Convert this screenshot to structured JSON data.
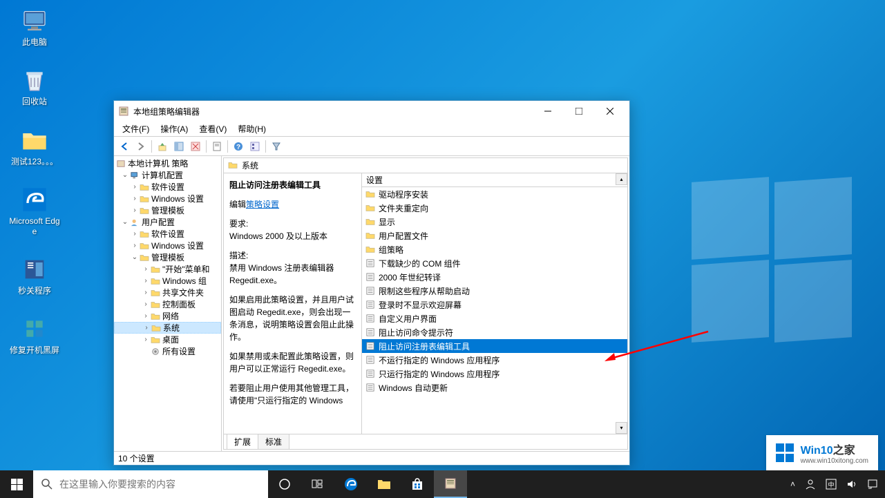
{
  "desktop": {
    "icons": [
      {
        "name": "此电脑",
        "type": "pc"
      },
      {
        "name": "回收站",
        "type": "recycle"
      },
      {
        "name": "测试123。。。",
        "type": "folder"
      },
      {
        "name": "Microsoft Edge",
        "type": "edge"
      },
      {
        "name": "秒关程序",
        "type": "app"
      },
      {
        "name": "修复开机黑屏",
        "type": "app2"
      }
    ]
  },
  "window": {
    "title": "本地组策略编辑器",
    "menus": [
      "文件(F)",
      "操作(A)",
      "查看(V)",
      "帮助(H)"
    ],
    "status": "10 个设置",
    "tabs": [
      "扩展",
      "标准"
    ],
    "active_tab": 0
  },
  "tree": {
    "root": "本地计算机 策略",
    "computer_config": "计算机配置",
    "computer_children": [
      "软件设置",
      "Windows 设置",
      "管理模板"
    ],
    "user_config": "用户配置",
    "user_children": [
      "软件设置",
      "Windows 设置"
    ],
    "admin_templates": "管理模板",
    "admin_children": [
      "\"开始\"菜单和",
      "Windows 组",
      "共享文件夹",
      "控制面板",
      "网络",
      "系统",
      "桌面",
      "所有设置"
    ],
    "selected": "系统"
  },
  "right": {
    "header": "系统",
    "list_header": "设置",
    "detail": {
      "title": "阻止访问注册表编辑工具",
      "edit_label": "编辑",
      "edit_link": "策略设置",
      "req_label": "要求:",
      "req_value": "Windows 2000 及以上版本",
      "desc_label": "描述:",
      "desc_p1": "禁用 Windows 注册表编辑器 Regedit.exe。",
      "desc_p2": "如果启用此策略设置，并且用户试图启动 Regedit.exe，则会出现一条消息，说明策略设置会阻止此操作。",
      "desc_p3": "如果禁用或未配置此策略设置，则用户可以正常运行 Regedit.exe。",
      "desc_p4": "若要阻止用户使用其他管理工具，请使用\"只运行指定的 Windows"
    },
    "items": [
      {
        "label": "驱动程序安装",
        "type": "folder"
      },
      {
        "label": "文件夹重定向",
        "type": "folder"
      },
      {
        "label": "显示",
        "type": "folder"
      },
      {
        "label": "用户配置文件",
        "type": "folder"
      },
      {
        "label": "组策略",
        "type": "folder"
      },
      {
        "label": "下载缺少的 COM 组件",
        "type": "setting"
      },
      {
        "label": "2000 年世纪转译",
        "type": "setting"
      },
      {
        "label": "限制这些程序从帮助启动",
        "type": "setting"
      },
      {
        "label": "登录时不显示欢迎屏幕",
        "type": "setting"
      },
      {
        "label": "自定义用户界面",
        "type": "setting"
      },
      {
        "label": "阻止访问命令提示符",
        "type": "setting"
      },
      {
        "label": "阻止访问注册表编辑工具",
        "type": "setting",
        "selected": true
      },
      {
        "label": "不运行指定的 Windows 应用程序",
        "type": "setting"
      },
      {
        "label": "只运行指定的 Windows 应用程序",
        "type": "setting"
      },
      {
        "label": "Windows 自动更新",
        "type": "setting"
      }
    ]
  },
  "taskbar": {
    "search_placeholder": "在这里输入你要搜索的内容"
  },
  "watermark": {
    "brand": "Win10",
    "suffix": "之家",
    "url": "www.win10xitong.com"
  }
}
